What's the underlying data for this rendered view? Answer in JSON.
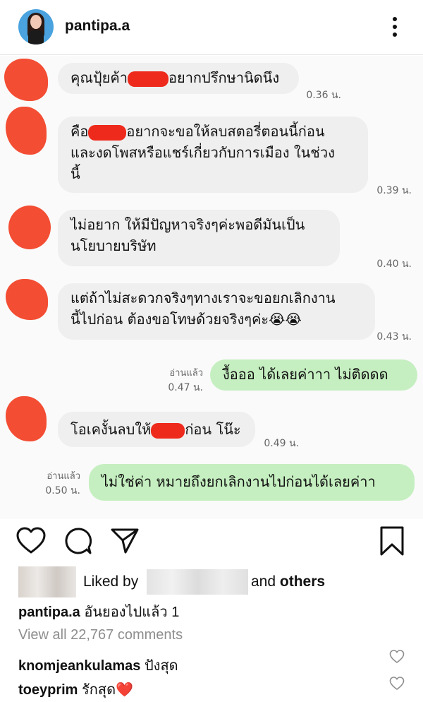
{
  "header": {
    "username": "pantipa.a"
  },
  "messages": [
    {
      "text_before": "คุณปุ้ยค้า",
      "text_after": "อยากปรึกษานิดนึง",
      "time": "0.36 น."
    },
    {
      "text_before": "คือ",
      "text_after": "อยากจะขอให้ลบสตอรี่ตอนนี้ก่อน",
      "line2": "และงดโพสหรือแชร์เกี่ยวกับการเมือง ในช่วง",
      "line3": "นี้",
      "time": "0.39 น."
    },
    {
      "line1": "ไม่อยาก ให้มีปัญหาจริงๆค่ะพอดีมันเป็น",
      "line2": "นโยบายบริษัท",
      "time": "0.40 น."
    },
    {
      "line1": "แต่ถ้าไม่สะดวกจริงๆทางเราจะขอยกเลิกงาน",
      "line2": "นี้ไปก่อน ต้องขอโทษด้วยจริงๆค่ะ😭😭",
      "time": "0.43 น."
    },
    {
      "read": "อ่านแล้ว",
      "time": "0.47 น.",
      "text": "งื้อออ ได้เลยค่าาา ไม่ติดดด"
    },
    {
      "text_before": "โอเคงั้นลบให้",
      "text_after": "ก่อน โน๊ะ",
      "time": "0.49 น."
    },
    {
      "read": "อ่านแล้ว",
      "time": "0.50 น.",
      "text": "ไม่ใช่ค่า หมายถึงยกเลิกงานไปก่อนได้เลยค่าา"
    }
  ],
  "likes": {
    "liked_by": "Liked by",
    "and": "and",
    "others": "others"
  },
  "caption": {
    "user": "pantipa.a",
    "text": " อันยองไปแล้ว 1"
  },
  "view_all": "View all 22,767 comments",
  "comments": [
    {
      "user": "knomjeankulamas",
      "text": " ปังสุด"
    },
    {
      "user": "toeyprim",
      "text": " รักสุด❤️"
    }
  ],
  "icons": [
    "heart-icon",
    "comment-icon",
    "share-icon",
    "bookmark-icon",
    "more-options-icon"
  ],
  "colors": {
    "incoming_bubble": "#efefef",
    "outgoing_bubble": "#c5efc0",
    "redaction": "#ee2a1c"
  }
}
